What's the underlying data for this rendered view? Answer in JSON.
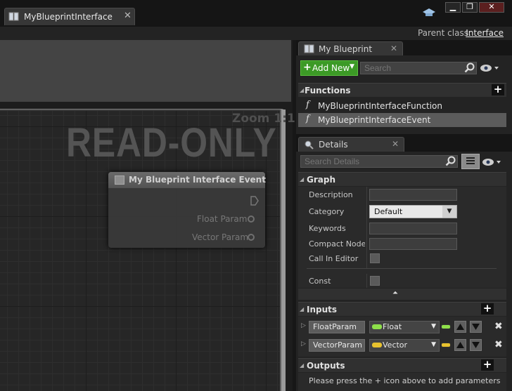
{
  "document_tab": {
    "title": "MyBlueprintInterface",
    "close": "✕"
  },
  "window_buttons": {
    "minimize": "▁",
    "maximize": "❐",
    "close": "✕"
  },
  "parent_class": {
    "label": "Parent class:",
    "value": "Interface"
  },
  "graph": {
    "zoom": "Zoom 1:1",
    "watermark": "READ-ONLY"
  },
  "node": {
    "title": "My Blueprint Interface Event",
    "pins": [
      "Float Param",
      "Vector Param"
    ]
  },
  "my_blueprint": {
    "tab_title": "My Blueprint",
    "add_new_label": "Add New",
    "search_placeholder": "Search",
    "functions_header": "Functions",
    "functions": [
      "MyBlueprintInterfaceFunction",
      "MyBlueprintInterfaceEvent"
    ]
  },
  "details": {
    "tab_title": "Details",
    "search_placeholder": "Search Details",
    "graph_header": "Graph",
    "properties": {
      "description": {
        "label": "Description",
        "value": ""
      },
      "category": {
        "label": "Category",
        "value": "Default"
      },
      "keywords": {
        "label": "Keywords",
        "value": ""
      },
      "compact_node_title": {
        "label": "Compact Node T",
        "value": ""
      },
      "call_in_editor": {
        "label": "Call In Editor",
        "checked": false
      },
      "const": {
        "label": "Const",
        "checked": false
      }
    },
    "inputs_header": "Inputs",
    "inputs": [
      {
        "name": "FloatParam",
        "type": "Float",
        "color": "#8ee04a"
      },
      {
        "name": "VectorParam",
        "type": "Vector",
        "color": "#e8c22e"
      }
    ],
    "outputs_header": "Outputs",
    "outputs_hint": "Please press the + icon above to add parameters"
  }
}
